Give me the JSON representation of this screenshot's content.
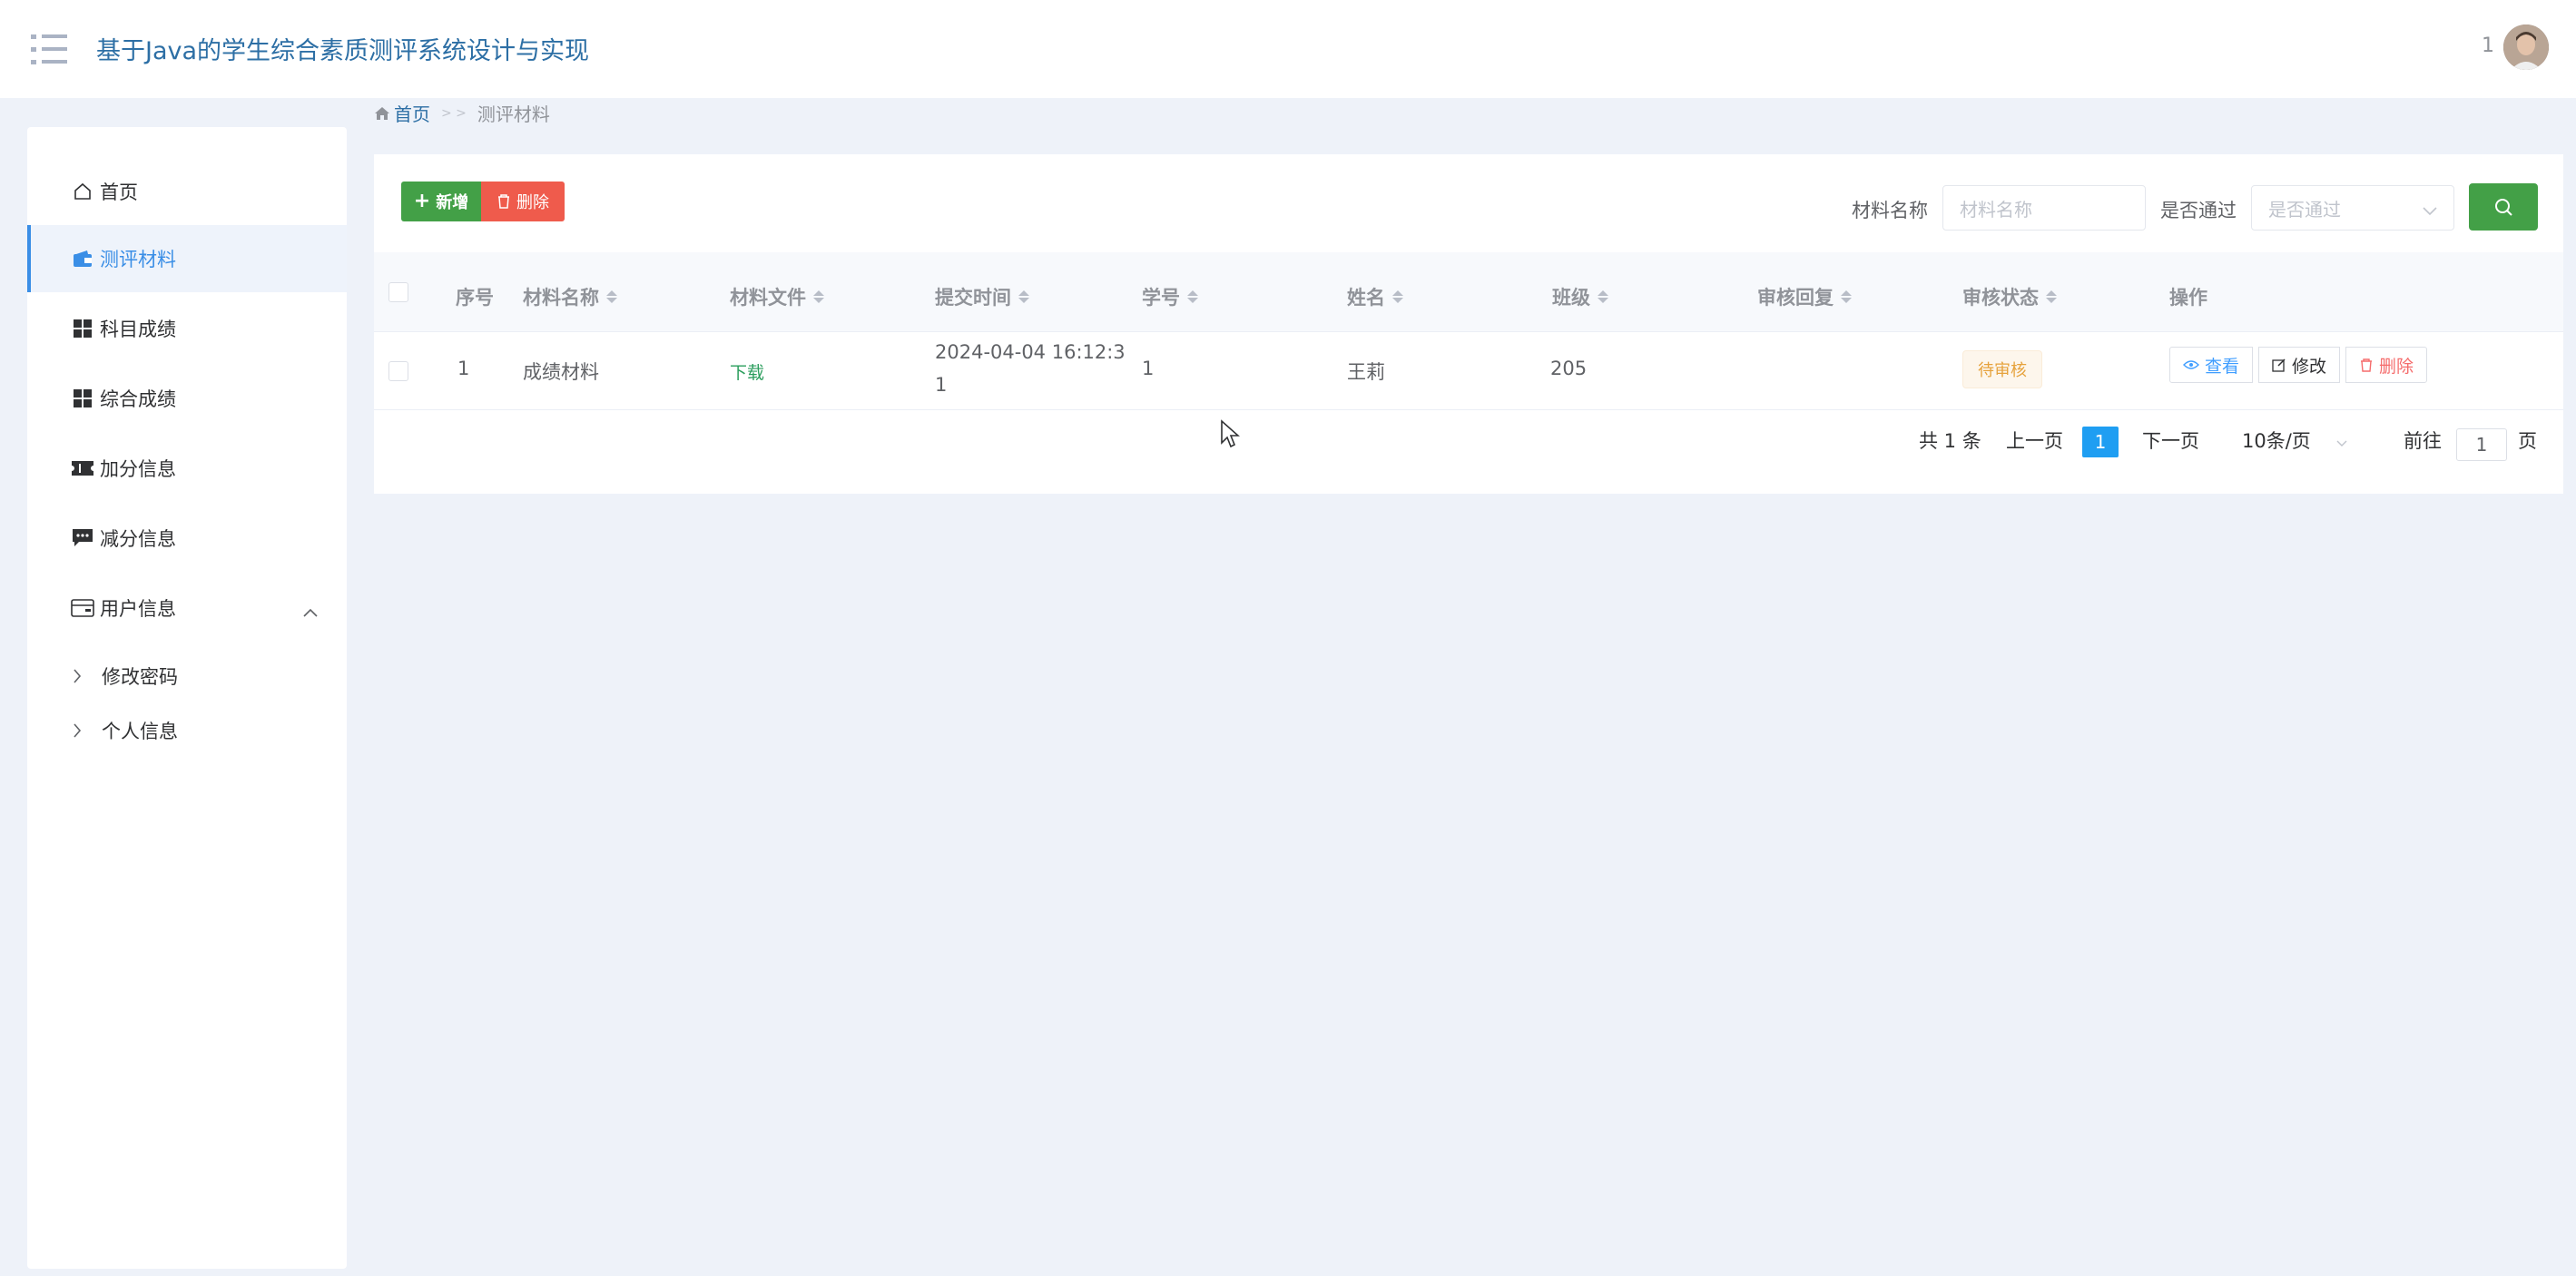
{
  "header": {
    "title": "基于Java的学生综合素质测评系统设计与实现",
    "user_num": "1"
  },
  "sidebar": {
    "items": [
      {
        "label": "首页",
        "icon": "home-icon"
      },
      {
        "label": "测评材料",
        "icon": "wallet-icon",
        "active": true
      },
      {
        "label": "科目成绩",
        "icon": "grid-icon"
      },
      {
        "label": "综合成绩",
        "icon": "grid-icon"
      },
      {
        "label": "加分信息",
        "icon": "ticket-icon"
      },
      {
        "label": "减分信息",
        "icon": "message-icon"
      },
      {
        "label": "用户信息",
        "icon": "card-icon",
        "expanded": true
      }
    ],
    "sub_items": [
      {
        "label": "修改密码"
      },
      {
        "label": "个人信息"
      }
    ]
  },
  "breadcrumb": {
    "home": "首页",
    "sep": "> >",
    "current": "测评材料"
  },
  "toolbar": {
    "add_label": "新增",
    "delete_label": "删除",
    "filter_name_label": "材料名称",
    "filter_name_placeholder": "材料名称",
    "filter_pass_label": "是否通过",
    "filter_pass_placeholder": "是否通过"
  },
  "table": {
    "columns": [
      "序号",
      "材料名称",
      "材料文件",
      "提交时间",
      "学号",
      "姓名",
      "班级",
      "审核回复",
      "审核状态",
      "操作"
    ],
    "rows": [
      {
        "index": "1",
        "name": "成绩材料",
        "file": "下载",
        "time": "2024-04-04 16:12:31",
        "student_id": "1",
        "student_name": "王莉",
        "class": "205",
        "reply": "",
        "status": "待审核",
        "actions": {
          "view": "查看",
          "edit": "修改",
          "delete": "删除"
        }
      }
    ]
  },
  "pagination": {
    "total": "共 1 条",
    "prev": "上一页",
    "current": "1",
    "next": "下一页",
    "page_size": "10条/页",
    "goto_label": "前往",
    "goto_value": "1",
    "page_suffix": "页"
  },
  "colors": {
    "primary": "#3a8ee6",
    "success": "#43a047",
    "danger": "#ef5b4c",
    "warning": "#e6a23c",
    "title": "#2d6fa5"
  }
}
